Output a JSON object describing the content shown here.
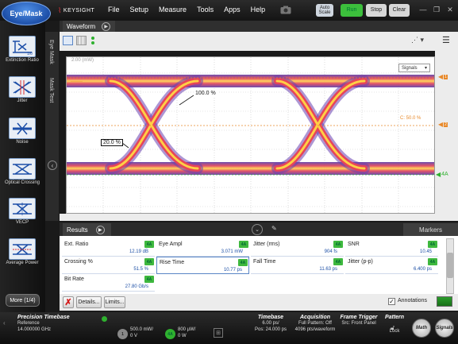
{
  "app": {
    "mode_button": "Eye/Mask",
    "logo": "KEYSIGHT",
    "menu": [
      "File",
      "Setup",
      "Measure",
      "Tools",
      "Apps",
      "Help"
    ],
    "buttons": {
      "autoscale": "Auto Scale",
      "run": "Run",
      "stop": "Stop",
      "clear": "Clear"
    }
  },
  "sidebar": {
    "items": [
      {
        "label": "Extinction Ratio",
        "icon": "extinction-ratio-icon"
      },
      {
        "label": "Jitter",
        "icon": "jitter-icon"
      },
      {
        "label": "Noise",
        "icon": "noise-icon"
      },
      {
        "label": "Optical Crossing",
        "icon": "crossing-icon"
      },
      {
        "label": "VECP",
        "icon": "vecp-icon"
      },
      {
        "label": "Average Power",
        "icon": "average-power-icon"
      }
    ],
    "more": "More (1/4)"
  },
  "vtabs": {
    "eye_mask": "Eye Mask",
    "mask_test": "Mask Test"
  },
  "waveform": {
    "tab": "Waveform",
    "scale_label": "2.00 (mW)",
    "trace_selector": "Signals",
    "label_100": "100.0 %",
    "label_200": "20.0 %",
    "crossing_label": "C: 50.0 %",
    "markers": [
      "1",
      "2",
      "4A"
    ]
  },
  "results": {
    "tab": "Results",
    "markers_tab": "Markers",
    "cells": [
      {
        "name": "Ext. Ratio",
        "value": "12.19 dB",
        "badge": "4A"
      },
      {
        "name": "Eye Ampl",
        "value": "3.071 mW",
        "badge": "4A"
      },
      {
        "name": "Jitter (rms)",
        "value": "904 fs",
        "badge": "4A"
      },
      {
        "name": "SNR",
        "value": "10.45",
        "badge": "4A"
      },
      {
        "name": "Crossing %",
        "value": "51.5 %",
        "badge": "4A"
      },
      {
        "name": "Rise Time",
        "value": "10.77 ps",
        "badge": "4A"
      },
      {
        "name": "Fall Time",
        "value": "11.63 ps",
        "badge": "4A"
      },
      {
        "name": "Jitter (p-p)",
        "value": "6.400 ps",
        "badge": "4A"
      },
      {
        "name": "Bit Rate",
        "value": "27.80 Gb/s",
        "badge": "4A"
      }
    ],
    "buttons": {
      "details": "Details...",
      "limits": "Limits..."
    },
    "annotations": "Annotations"
  },
  "status": {
    "timebase_title": "Precision Timebase",
    "timebase_ref_label": "Reference",
    "timebase_freq": "14.000000 GHz",
    "ch1_value": "500.0 mW/",
    "ch1_offset": "0 V",
    "ch4_badge": "4A",
    "ch4_value": "800 µW/",
    "ch4_offset": "0 W",
    "timebase": {
      "title": "Timebase",
      "line1": "6.00 ps/",
      "line2": "Pos: 24.000 ps"
    },
    "acquisition": {
      "title": "Acquisition",
      "line1": "Full Pattern: Off",
      "line2": "4096 pts/waveform"
    },
    "trigger": {
      "title": "Frame Trigger",
      "line1": "Src: Front Panel"
    },
    "pattern": {
      "title": "Pattern",
      "line1": "Lock"
    },
    "math_label": "Math",
    "signals_label": "Signals"
  },
  "colors": {
    "accent_green": "#3eb83e",
    "mode_blue": "#2a63c4",
    "marker_orange": "#e8892a"
  }
}
